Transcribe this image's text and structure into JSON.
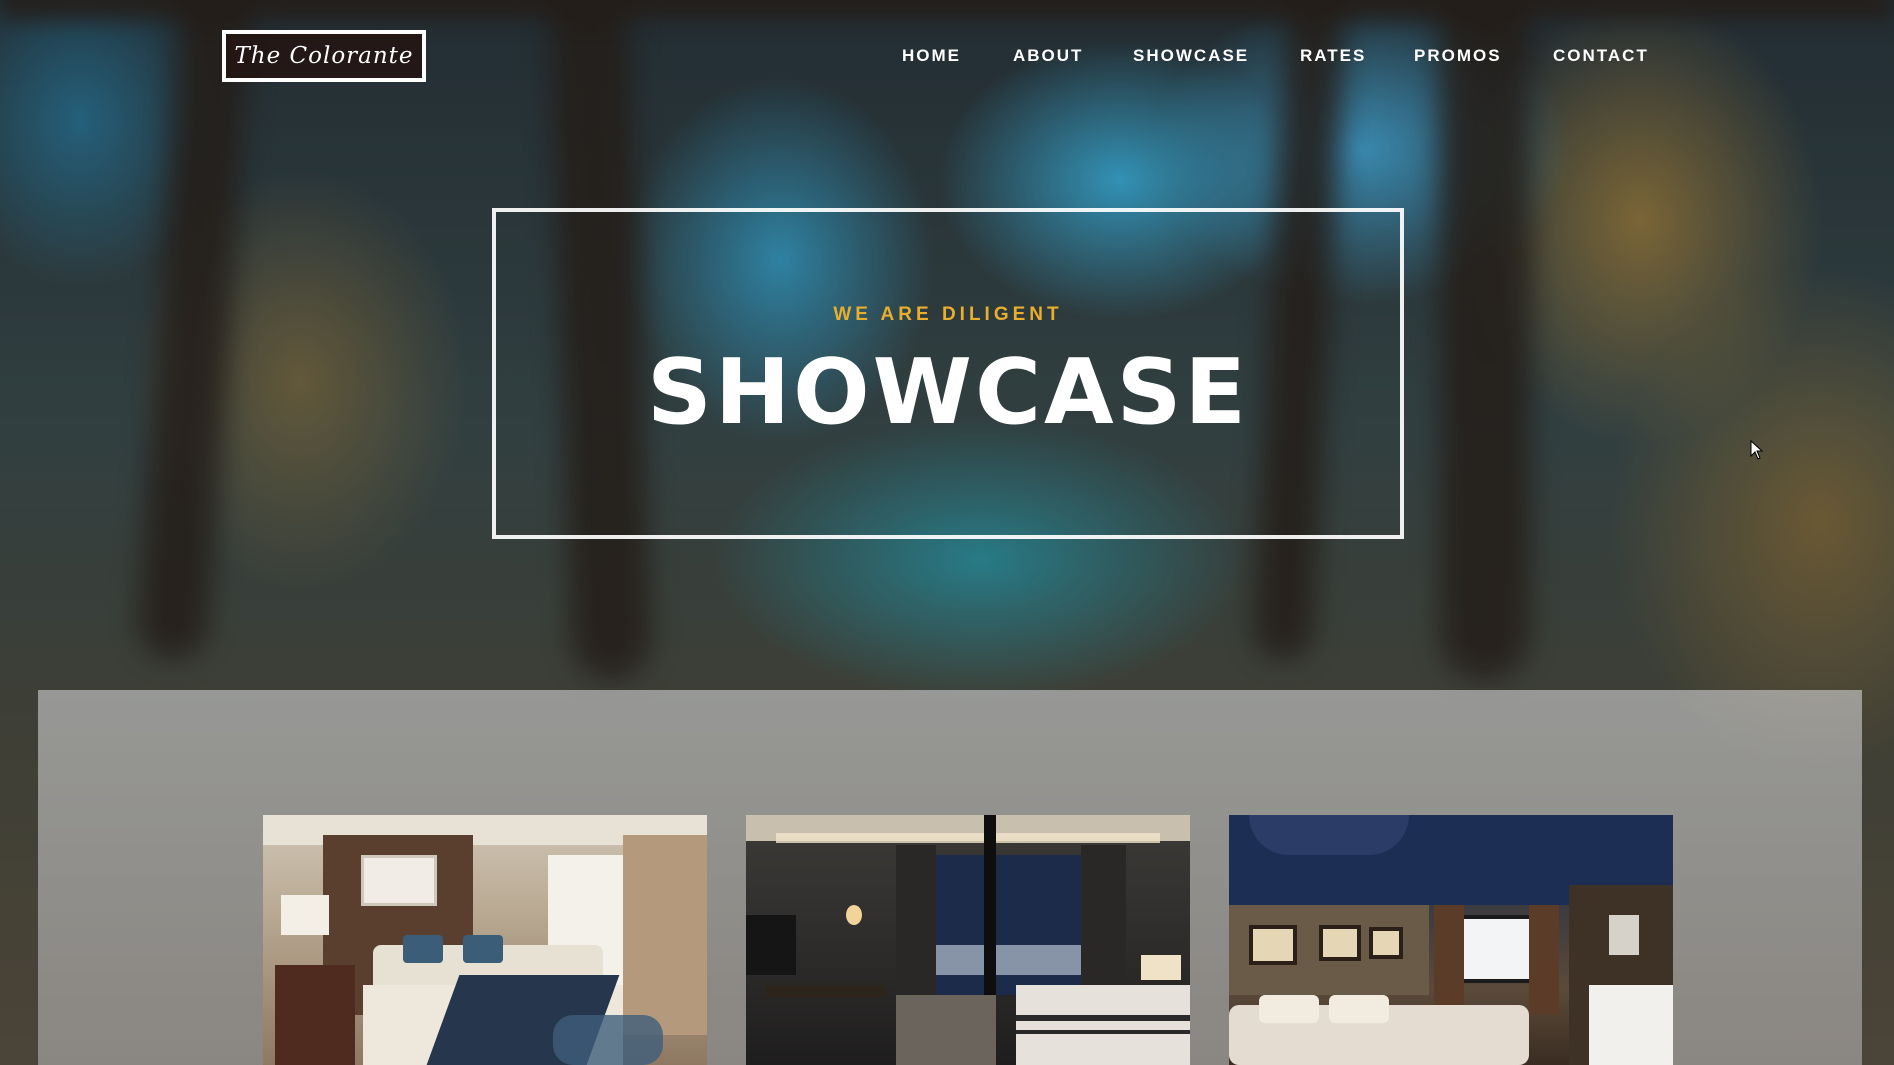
{
  "brand": {
    "logo_text": "The Colorante"
  },
  "nav": {
    "items": [
      {
        "label": "HOME"
      },
      {
        "label": "ABOUT"
      },
      {
        "label": "SHOWCASE"
      },
      {
        "label": "RATES"
      },
      {
        "label": "PROMOS"
      },
      {
        "label": "CONTACT"
      }
    ]
  },
  "hero": {
    "subtitle": "WE ARE DILIGENT",
    "title": "SHOWCASE"
  },
  "showcase": {
    "images": [
      {
        "name": "room-image-1",
        "icon": "bedroom-photo"
      },
      {
        "name": "room-image-2",
        "icon": "bedroom-photo"
      },
      {
        "name": "room-image-3",
        "icon": "bedroom-photo"
      }
    ]
  },
  "colors": {
    "accent": "#e8ae2c",
    "text": "#ffffff",
    "logo_bg": "#23140f"
  }
}
